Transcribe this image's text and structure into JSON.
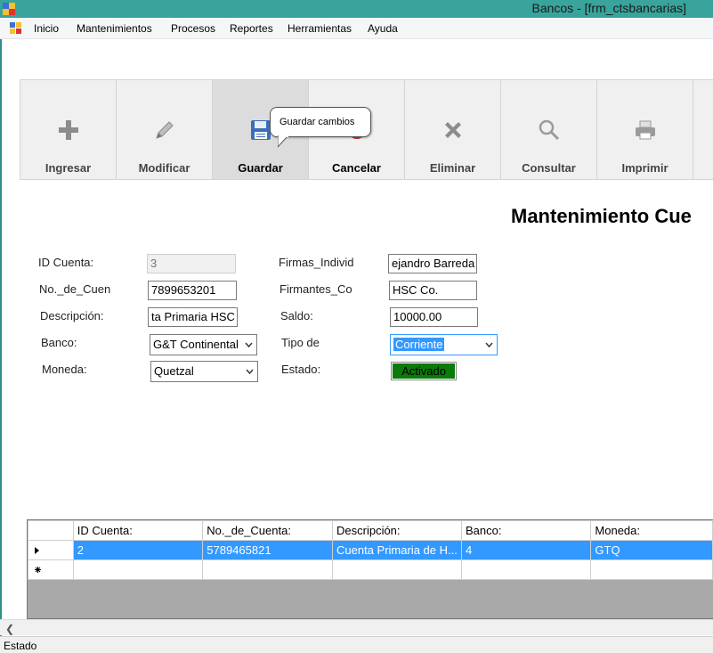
{
  "window": {
    "title": "Bancos - [frm_ctsbancarias]"
  },
  "menu": [
    "Inicio",
    "Mantenimientos",
    "Procesos",
    "Reportes",
    "Herramientas",
    "Ayuda"
  ],
  "toolbar": {
    "ingresar": "Ingresar",
    "modificar": "Modificar",
    "guardar": "Guardar",
    "cancelar": "Cancelar",
    "eliminar": "Eliminar",
    "consultar": "Consultar",
    "imprimir": "Imprimir"
  },
  "tooltip": "Guardar cambios",
  "heading": "Mantenimiento Cue",
  "form": {
    "id_label": "ID Cuenta:",
    "id_value": "3",
    "no_label": "No._de_Cuen",
    "no_value": "7899653201",
    "desc_label": "Descripción:",
    "desc_value": "ta Primaria HSC",
    "banco_label": "Banco:",
    "banco_value": "G&T Continental",
    "moneda_label": "Moneda:",
    "moneda_value": "Quetzal",
    "firmas_label": "Firmas_Individ",
    "firmas_value": "ejandro Barreda",
    "firmantes_label": "Firmantes_Co",
    "firmantes_value": "HSC Co.",
    "saldo_label": "Saldo:",
    "saldo_value": "10000.00",
    "tipo_label": "Tipo de",
    "tipo_value": "Corriente",
    "estado_label": "Estado:",
    "estado_value": "Activado"
  },
  "grid": {
    "columns": [
      "ID Cuenta:",
      "No._de_Cuenta:",
      "Descripción:",
      "Banco:",
      "Moneda:"
    ],
    "rows": [
      [
        "2",
        "5789465821",
        "Cuenta Primaria de H...",
        "4",
        "GTQ"
      ]
    ]
  },
  "status": "Estado",
  "colors": {
    "titlebar": "#38a49b",
    "selection": "#3399ff",
    "activo": "#0a7a0a"
  }
}
